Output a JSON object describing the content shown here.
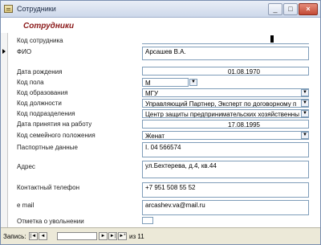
{
  "window": {
    "title": "Сотрудники",
    "min_symbol": "_",
    "max_symbol": "□",
    "close_symbol": "×"
  },
  "form": {
    "heading": "Сотрудники"
  },
  "fields": [
    {
      "label": "Код сотрудника",
      "value": ""
    },
    {
      "label": "ФИО",
      "value": "Арсашев В.А."
    },
    {
      "label": "Дата рождения",
      "value": "01.08.1970"
    },
    {
      "label": "Код пола",
      "value": "М"
    },
    {
      "label": "Код образования",
      "value": "МГУ"
    },
    {
      "label": "Код должности",
      "value": "Управляющий Партнер, Эксперт по договорному п"
    },
    {
      "label": "Код подразделения",
      "value": "Центр защиты предпринимательских хозяйственны"
    },
    {
      "label": "Дата принятия на работу",
      "value": "17.08.1995"
    },
    {
      "label": "Код семейного положения",
      "value": "Женат"
    },
    {
      "label": "Паспортные данные",
      "value": "I. 04 566574"
    },
    {
      "label": "Адрес",
      "value": "ул.Бехтерева, д.4, кв.44"
    },
    {
      "label": "Контактный телефон",
      "value": "+7 951 508 55 52"
    },
    {
      "label": "e mail",
      "value": "arcashev.va@mail.ru"
    },
    {
      "label": "Отметка о увольнении",
      "value": ""
    }
  ],
  "navigation": {
    "label": "Запись:",
    "first": "|◄",
    "prev": "◄",
    "next": "►",
    "last": "►|",
    "new": "►*",
    "of_text": "из 11"
  },
  "icons": {
    "dropdown": "▼"
  }
}
